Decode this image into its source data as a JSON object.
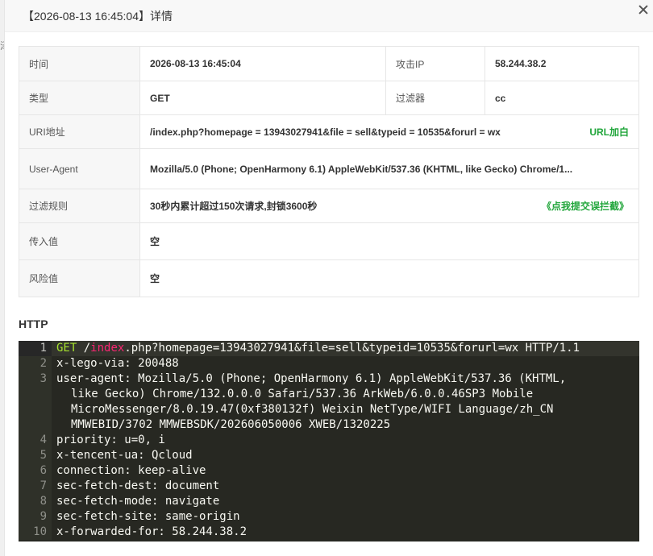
{
  "colors": {
    "accent": "#20a53a",
    "code_bg": "#272822"
  },
  "modal": {
    "title": "【2026-08-13 16:45:04】详情"
  },
  "background": {
    "left_text": "泽"
  },
  "details": {
    "time_label": "时间",
    "time_value": "2026-08-13 16:45:04",
    "ip_label": "攻击IP",
    "ip_value": "58.244.38.2",
    "type_label": "类型",
    "type_value": "GET",
    "filter_label": "过滤器",
    "filter_value": "cc",
    "uri_label": "URI地址",
    "uri_value": "/index.php?homepage = 13943027941&file = sell&typeid = 10535&forurl = wx",
    "uri_action": "URL加白",
    "ua_label": "User-Agent",
    "ua_value": "Mozilla/5.0 (Phone; OpenHarmony 6.1) AppleWebKit/537.36 (KHTML, like Gecko) Chrome/1...",
    "rule_label": "过滤规则",
    "rule_value": "30秒内累计超过150次请求,封锁3600秒",
    "rule_action": "《点我提交误拦截》",
    "input_label": "传入值",
    "input_value": "空",
    "risk_label": "风险值",
    "risk_value": "空"
  },
  "http": {
    "title": "HTTP",
    "line1": {
      "num": "1",
      "method": "GET",
      "sp": " /",
      "path": "index",
      "rest": ".php?homepage=13943027941&file=sell&typeid=10535&forurl=wx HTTP/1.1"
    },
    "lines": [
      {
        "num": "2",
        "text": "x-lego-via: 200488"
      },
      {
        "num": "3",
        "text": "user-agent: Mozilla/5.0 (Phone; OpenHarmony 6.1) AppleWebKit/537.36 (KHTML,"
      },
      {
        "num": "",
        "text": "like Gecko) Chrome/132.0.0.0 Safari/537.36 ArkWeb/6.0.0.46SP3 Mobile"
      },
      {
        "num": "",
        "text": "MicroMessenger/8.0.19.47(0xf380132f) Weixin NetType/WIFI Language/zh_CN"
      },
      {
        "num": "",
        "text": "MMWEBID/3702 MMWEBSDK/202606050006 XWEB/1320225"
      },
      {
        "num": "4",
        "text": "priority: u=0, i"
      },
      {
        "num": "5",
        "text": "x-tencent-ua: Qcloud"
      },
      {
        "num": "6",
        "text": "connection: keep-alive"
      },
      {
        "num": "7",
        "text": "sec-fetch-dest: document"
      },
      {
        "num": "8",
        "text": "sec-fetch-mode: navigate"
      },
      {
        "num": "9",
        "text": "sec-fetch-site: same-origin"
      },
      {
        "num": "10",
        "text": "x-forwarded-for: 58.244.38.2"
      }
    ]
  }
}
